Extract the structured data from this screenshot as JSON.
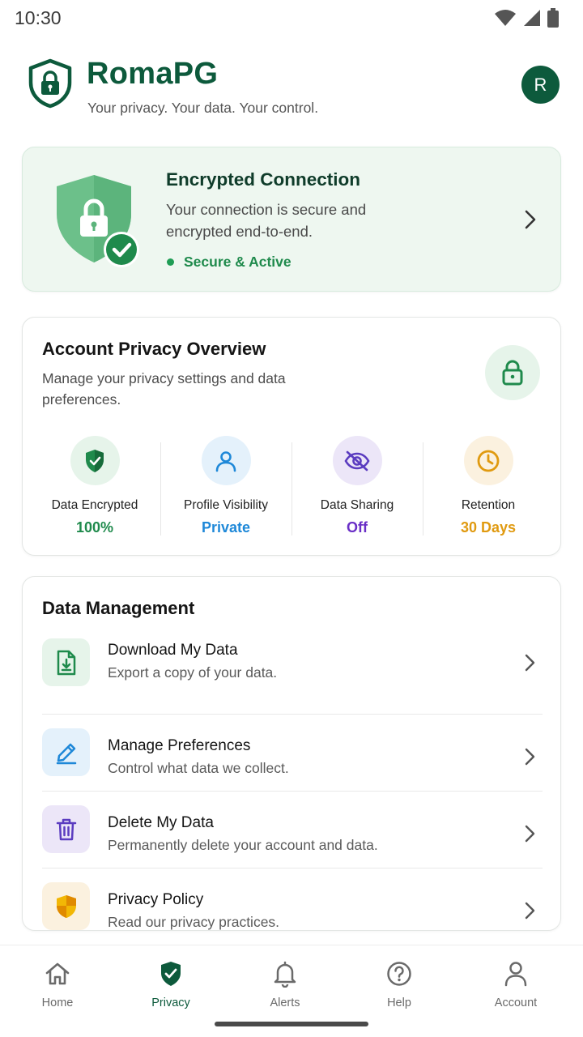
{
  "status_bar": {
    "time": "10:30"
  },
  "header": {
    "title": "RomaPG",
    "tagline": "Your privacy. Your data. Your control.",
    "avatar_initial": "R"
  },
  "connection_card": {
    "title": "Encrypted Connection",
    "description": "Your connection is secure and encrypted end-to-end.",
    "status": "Secure & Active"
  },
  "overview": {
    "title": "Account Privacy Overview",
    "description": "Manage your privacy settings and data preferences.",
    "stats": [
      {
        "label": "Data Encrypted",
        "value": "100%",
        "icon": "shield-check-icon",
        "color": "#1f8a4c"
      },
      {
        "label": "Profile Visibility",
        "value": "Private",
        "icon": "user-icon",
        "color": "#1e88d8"
      },
      {
        "label": "Data Sharing",
        "value": "Off",
        "icon": "eye-off-icon",
        "color": "#6a2fc7"
      },
      {
        "label": "Retention",
        "value": "30 Days",
        "icon": "clock-icon",
        "color": "#e09a10"
      }
    ]
  },
  "data_management": {
    "title": "Data Management",
    "items": [
      {
        "label": "Download My Data",
        "subtitle": "Export a copy of your data.",
        "icon": "download-file-icon"
      },
      {
        "label": "Manage Preferences",
        "subtitle": "Control what data we collect.",
        "icon": "pencil-icon"
      },
      {
        "label": "Delete My Data",
        "subtitle": "Permanently delete your account and data.",
        "icon": "trash-icon"
      },
      {
        "label": "Privacy Policy",
        "subtitle": "Read our privacy practices.",
        "icon": "shield-icon"
      }
    ]
  },
  "bottom_nav": {
    "items": [
      {
        "label": "Home",
        "icon": "home-icon"
      },
      {
        "label": "Privacy",
        "icon": "shield-icon",
        "active": true
      },
      {
        "label": "Alerts",
        "icon": "bell-icon"
      },
      {
        "label": "Help",
        "icon": "help-icon"
      },
      {
        "label": "Account",
        "icon": "person-icon"
      }
    ]
  },
  "colors": {
    "brand": "#0d5a3c",
    "success": "#1f8a4c",
    "card_tint": "#eef7f0"
  }
}
